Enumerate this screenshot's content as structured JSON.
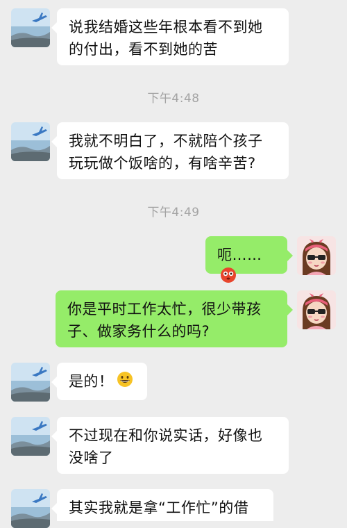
{
  "messages": [
    {
      "lines": [
        "说我结婚这些年根本看不到她",
        "的付出，看不到她的苦"
      ]
    },
    {
      "time": "下午4:48"
    },
    {
      "lines": [
        "我就不明白了，不就陪个孩子",
        "玩玩做个饭啥的，有啥辛苦?"
      ]
    },
    {
      "time": "下午4:49"
    },
    {
      "text": "呃……",
      "emoji": "flushed-face-icon"
    },
    {
      "lines": [
        "你是平时工作太忙，很少带孩",
        "子、做家务什么的吗?"
      ]
    },
    {
      "text": "是的！",
      "emoji": "grinning-face-icon"
    },
    {
      "lines": [
        "不过现在和你说实话，好像也",
        "没啥了"
      ]
    },
    {
      "lines": [
        "其实我就是拿“工作忙”的借"
      ]
    }
  ],
  "colors": {
    "background": "#ededed",
    "incoming_bubble": "#ffffff",
    "outgoing_bubble": "#95ec69",
    "timestamp": "#a3a3a3"
  }
}
